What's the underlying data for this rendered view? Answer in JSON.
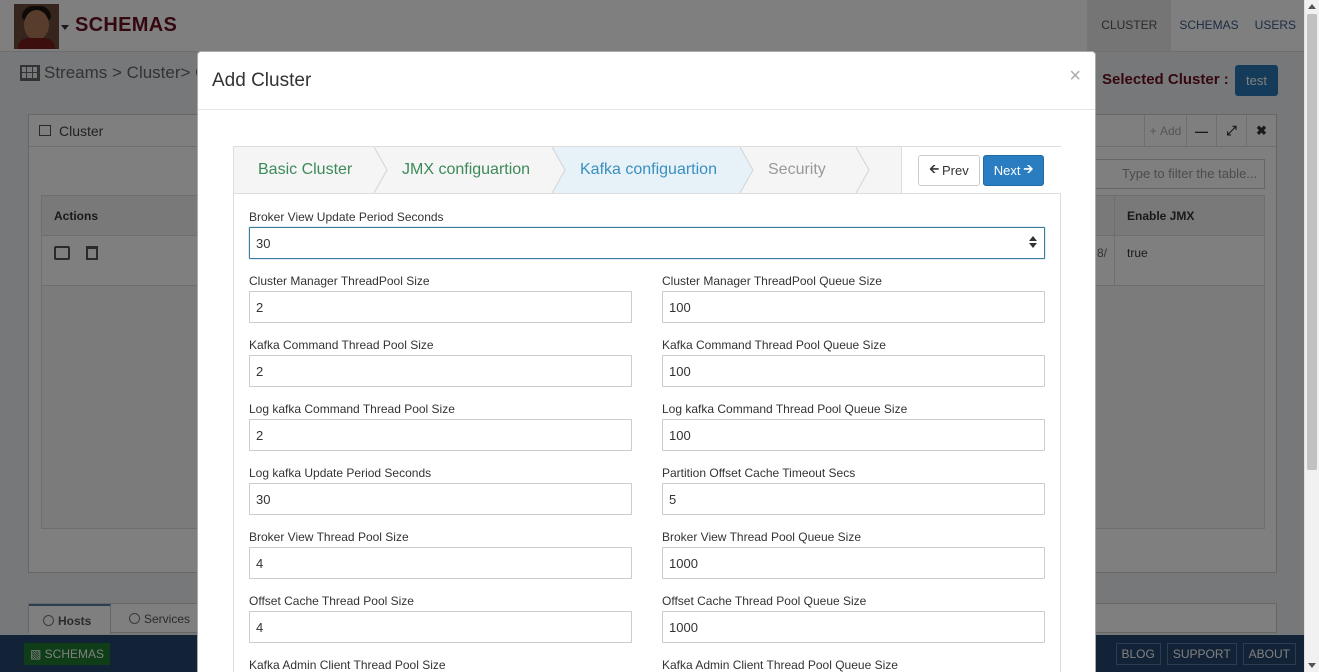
{
  "app": {
    "brand": "SCHEMAS",
    "nav": [
      "CLUSTER",
      "SCHEMAS",
      "USERS"
    ],
    "active_nav": "CLUSTER"
  },
  "breadcrumb": "Streams > Cluster> Clus",
  "selected_cluster": {
    "label": "Selected Cluster :",
    "value": "test"
  },
  "cluster_panel": {
    "title": "Cluster",
    "add_label": "Add",
    "filter_placeholder": "Type to filter the table...",
    "columns": {
      "actions": "Actions",
      "enable_jmx": "Enable JMX"
    },
    "row": {
      "truncated_cell": "8/",
      "enable_jmx": "true"
    }
  },
  "bottom_tabs": [
    "Hosts",
    "Services"
  ],
  "footer": {
    "left": "SCHEMAS",
    "right": [
      "BLOG",
      "SUPPORT",
      "ABOUT"
    ]
  },
  "modal": {
    "title": "Add Cluster",
    "close": "×",
    "steps": [
      "Basic Cluster",
      "JMX configuartion",
      "Kafka configuartion",
      "Security"
    ],
    "active_step": "Kafka configuartion",
    "prev": "Prev",
    "next": "Next",
    "fields": {
      "broker_view_update_period_seconds": {
        "label": "Broker View Update Period Seconds",
        "value": "30"
      },
      "cluster_manager_threadpool_size": {
        "label": "Cluster Manager ThreadPool Size",
        "value": "2"
      },
      "cluster_manager_threadpool_queue_size": {
        "label": "Cluster Manager ThreadPool Queue Size",
        "value": "100"
      },
      "kafka_command_thread_pool_size": {
        "label": "Kafka Command Thread Pool Size",
        "value": "2"
      },
      "kafka_command_thread_pool_queue_size": {
        "label": "Kafka Command Thread Pool Queue Size",
        "value": "100"
      },
      "log_kafka_command_thread_pool_size": {
        "label": "Log kafka Command Thread Pool Size",
        "value": "2"
      },
      "log_kafka_command_thread_pool_queue_size": {
        "label": "Log kafka Command Thread Pool Queue Size",
        "value": "100"
      },
      "log_kafka_update_period_seconds": {
        "label": "Log kafka Update Period Seconds",
        "value": "30"
      },
      "partition_offset_cache_timeout_secs": {
        "label": "Partition Offset Cache Timeout Secs",
        "value": "5"
      },
      "broker_view_thread_pool_size": {
        "label": "Broker View Thread Pool Size",
        "value": "4"
      },
      "broker_view_thread_pool_queue_size": {
        "label": "Broker View Thread Pool Queue Size",
        "value": "1000"
      },
      "offset_cache_thread_pool_size": {
        "label": "Offset Cache Thread Pool Size",
        "value": "4"
      },
      "offset_cache_thread_pool_queue_size": {
        "label": "Offset Cache Thread Pool Queue Size",
        "value": "1000"
      },
      "kafka_admin_client_thread_pool_size": {
        "label": "Kafka Admin Client Thread Pool Size",
        "value": ""
      },
      "kafka_admin_client_thread_pool_queue_size": {
        "label": "Kafka Admin Client Thread Pool Queue Size",
        "value": ""
      }
    }
  },
  "colors": {
    "brand": "#6b0e1e",
    "primary": "#2a7dc0",
    "step_done": "#3c8a5a",
    "step_active": "#3a8fbf",
    "footer": "#26476e"
  }
}
